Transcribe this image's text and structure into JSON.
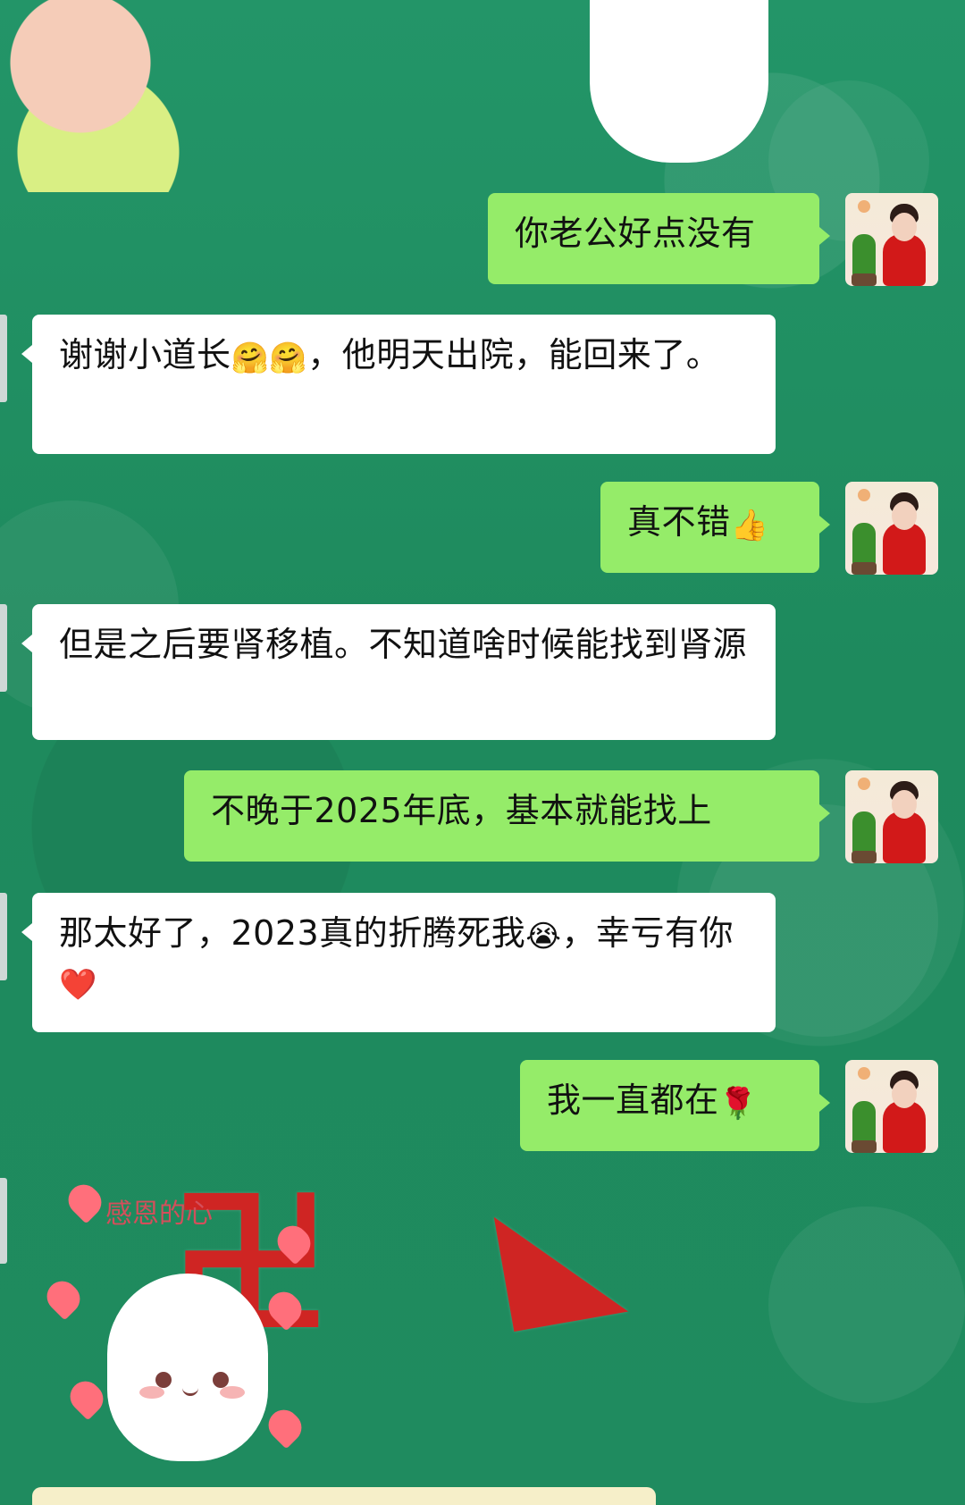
{
  "chat": {
    "messages": [
      {
        "side": "right",
        "text": "你老公好点没有"
      },
      {
        "side": "left",
        "text_parts": [
          "谢谢小道长",
          "🤗🤗",
          "，他明天出院，能回来了。"
        ]
      },
      {
        "side": "right",
        "text_parts": [
          "真不错",
          "👍"
        ]
      },
      {
        "side": "left",
        "text": "但是之后要肾移植。不知道啥时候能找到肾源"
      },
      {
        "side": "right",
        "text": "不晚于2025年底，基本就能找上"
      },
      {
        "side": "left",
        "text_parts": [
          "那太好了，2023真的折腾死我",
          "😭",
          "，幸亏有你",
          "❤️"
        ]
      },
      {
        "side": "right",
        "text_parts": [
          "我一直都在",
          "🌹"
        ]
      }
    ],
    "sticker_caption": "感恩的心"
  },
  "background": {
    "primary_color": "#1f8a5b",
    "accent_red": "#d92020"
  },
  "icons": {
    "avatar": "profile-avatar-icon",
    "sticker": "sticker-icon",
    "heart": "heart-icon"
  }
}
